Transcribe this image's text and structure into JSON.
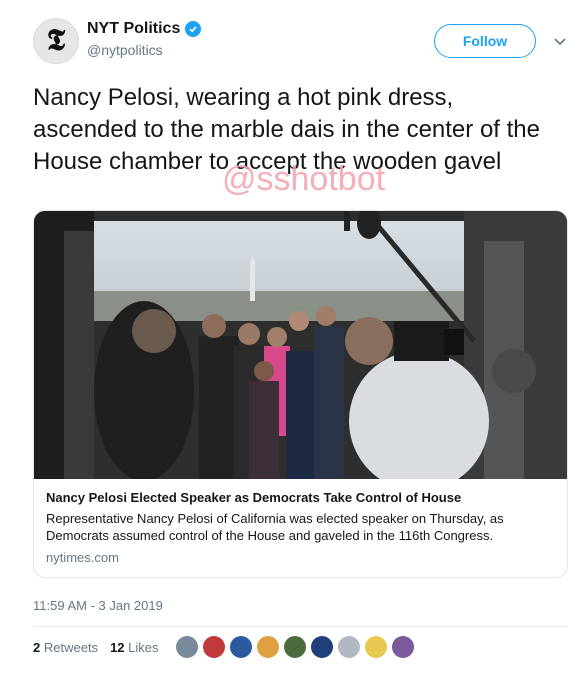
{
  "account": {
    "avatar_letter": "𝕿",
    "display_name": "NYT Politics",
    "handle": "@nytpolitics",
    "follow_label": "Follow"
  },
  "tweet": {
    "text": "Nancy Pelosi, wearing a hot pink dress, ascended to the marble dais in the center of the House chamber to accept the wooden gavel",
    "timestamp": "11:59 AM - 3 Jan 2019"
  },
  "watermark": "@sshotbot",
  "card": {
    "title": "Nancy Pelosi Elected Speaker as Democrats Take Control of House",
    "description": "Representative Nancy Pelosi of California was elected speaker on Thursday, as Democrats assumed control of the House and gaveled in the 116th Congress.",
    "domain": "nytimes.com"
  },
  "stats": {
    "retweets_count": "2",
    "retweets_label": "Retweets",
    "likes_count": "12",
    "likes_label": "Likes"
  },
  "colors": {
    "accent": "#1da1f2",
    "secondary_text": "#657786"
  },
  "likers": [
    "#7b8a9b",
    "#c03a3a",
    "#2c5aa0",
    "#e0a040",
    "#4d6b3c",
    "#1f3f7a",
    "#b0b8c0",
    "#e8c850",
    "#7a5a9a"
  ]
}
